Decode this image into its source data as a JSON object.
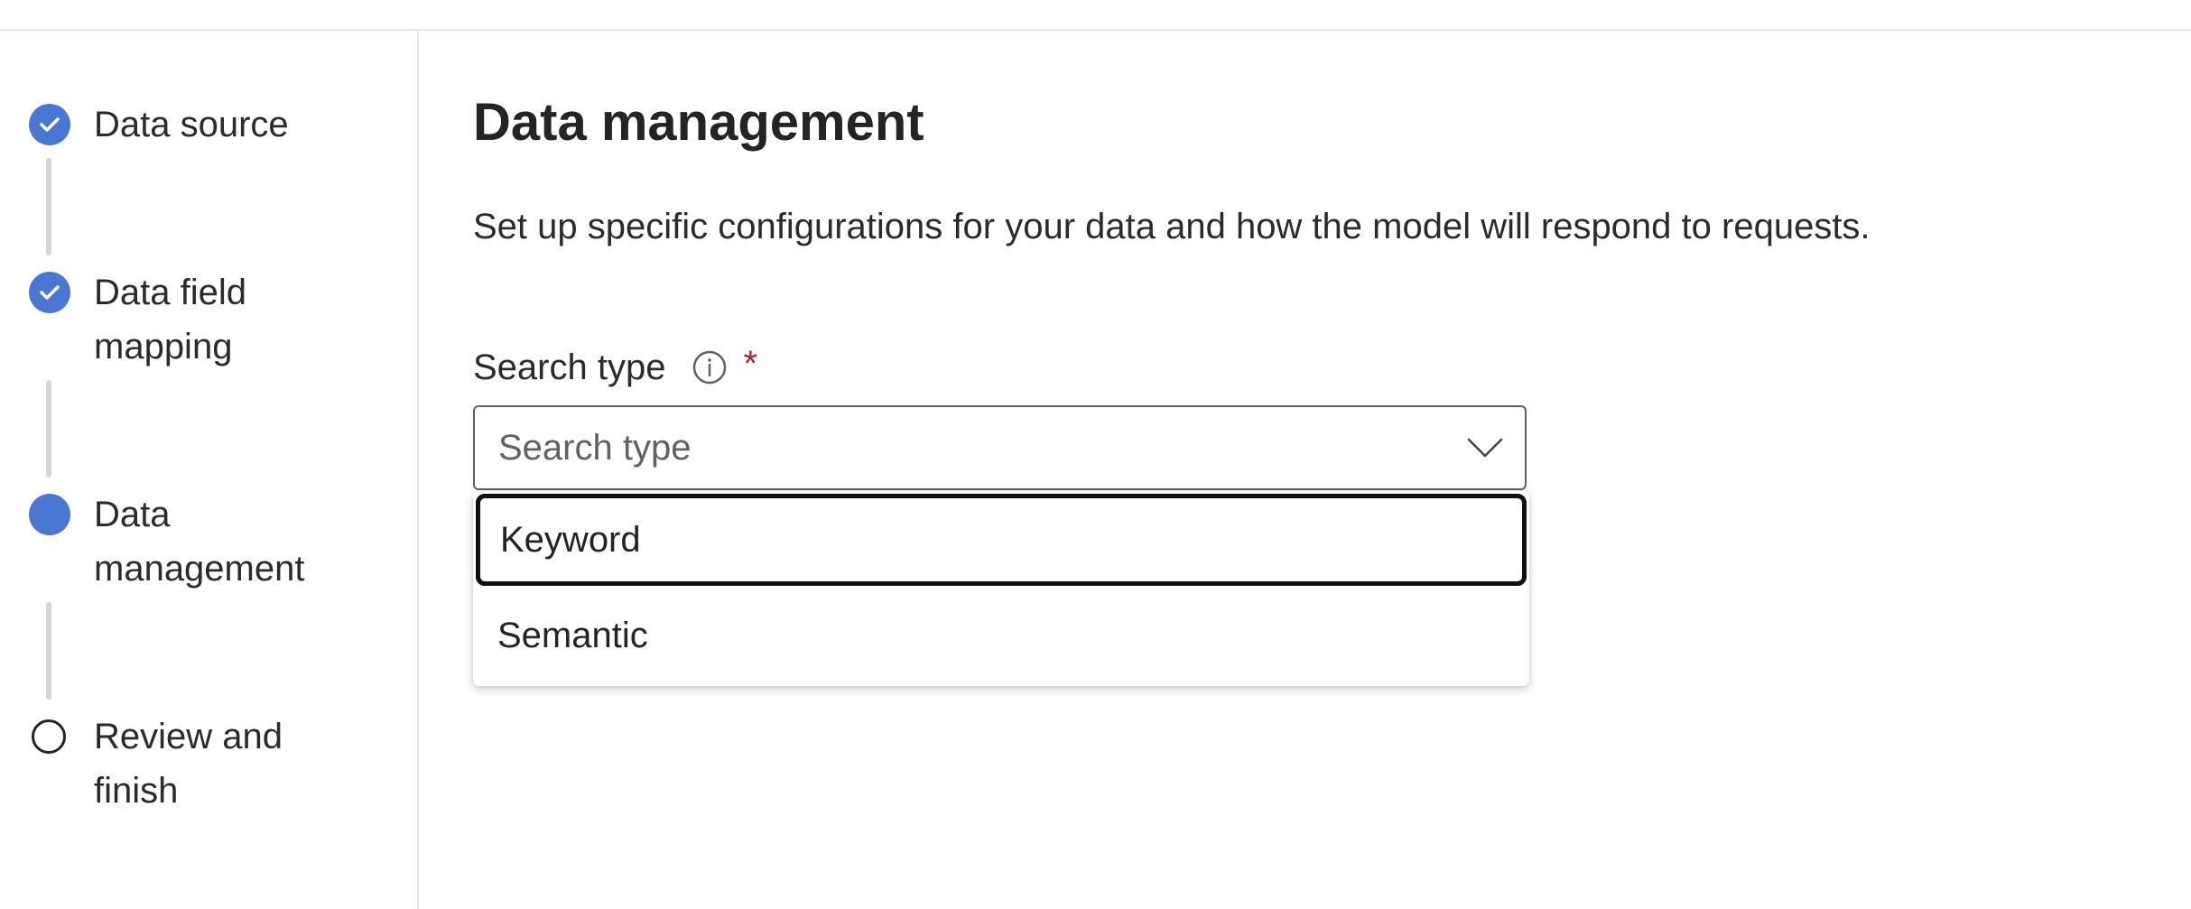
{
  "wizard": {
    "steps": [
      {
        "label": "Data source",
        "status": "completed",
        "icon": "check-icon"
      },
      {
        "label": "Data field mapping",
        "label_lines": [
          "Data field",
          "mapping"
        ],
        "status": "completed",
        "icon": "check-icon"
      },
      {
        "label": "Data management",
        "label_lines": [
          "Data",
          "management"
        ],
        "status": "current",
        "icon": "current-step-dot"
      },
      {
        "label": "Review and finish",
        "label_lines": [
          "Review and",
          "finish"
        ],
        "status": "pending",
        "icon": "empty-circle-icon"
      }
    ]
  },
  "main": {
    "title": "Data management",
    "description": "Set up specific configurations for your data and how the model will respond to requests.",
    "search_type": {
      "label": "Search type",
      "info_icon": "info-icon",
      "required_marker": "*",
      "placeholder": "Search type",
      "chevron_icon": "chevron-down-icon",
      "expanded": true,
      "options": [
        "Keyword",
        "Semantic"
      ],
      "focused_option": "Keyword"
    }
  },
  "colors": {
    "accent": "#4a76d4",
    "required": "#a4262c",
    "text": "#242424",
    "divider": "#e6e6e6"
  }
}
